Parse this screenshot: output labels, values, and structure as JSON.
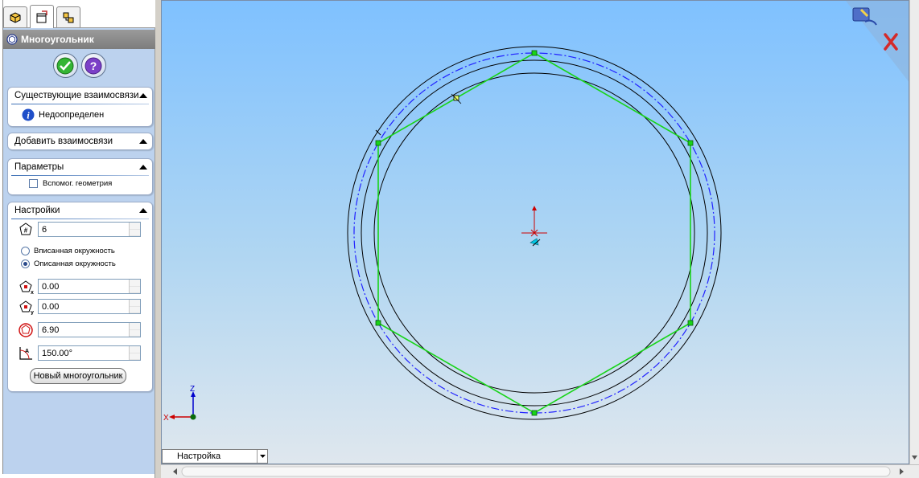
{
  "tabs": [
    {
      "name": "feature-manager"
    },
    {
      "name": "property-manager"
    },
    {
      "name": "configuration-manager"
    }
  ],
  "panel": {
    "title": "Многоугольник"
  },
  "groups": {
    "existing_relations": {
      "title": "Существующие взаимосвязи",
      "status": "Недоопределен"
    },
    "add_relations": {
      "title": "Добавить взаимосвязи"
    },
    "parameters": {
      "title": "Параметры",
      "construction_label": "Вспомог. геометрия",
      "construction_checked": false
    },
    "settings": {
      "title": "Настройки",
      "sides": "6",
      "inscribed_label": "Вписанная окружность",
      "circumscribed_label": "Описанная окружность",
      "selected": "circumscribed",
      "center_x": "0.00",
      "center_y": "0.00",
      "diameter": "6.90",
      "angle": "150.00°",
      "new_polygon_label": "Новый многоугольник"
    }
  },
  "config_combo": {
    "value": "Настройка"
  },
  "triad": {
    "x_label": "X",
    "z_label": "Z"
  },
  "colors": {
    "polygon": "#19d419",
    "blue_circle": "#2222ff",
    "axis_x": "#cc0000",
    "axis_z": "#0000cc"
  }
}
